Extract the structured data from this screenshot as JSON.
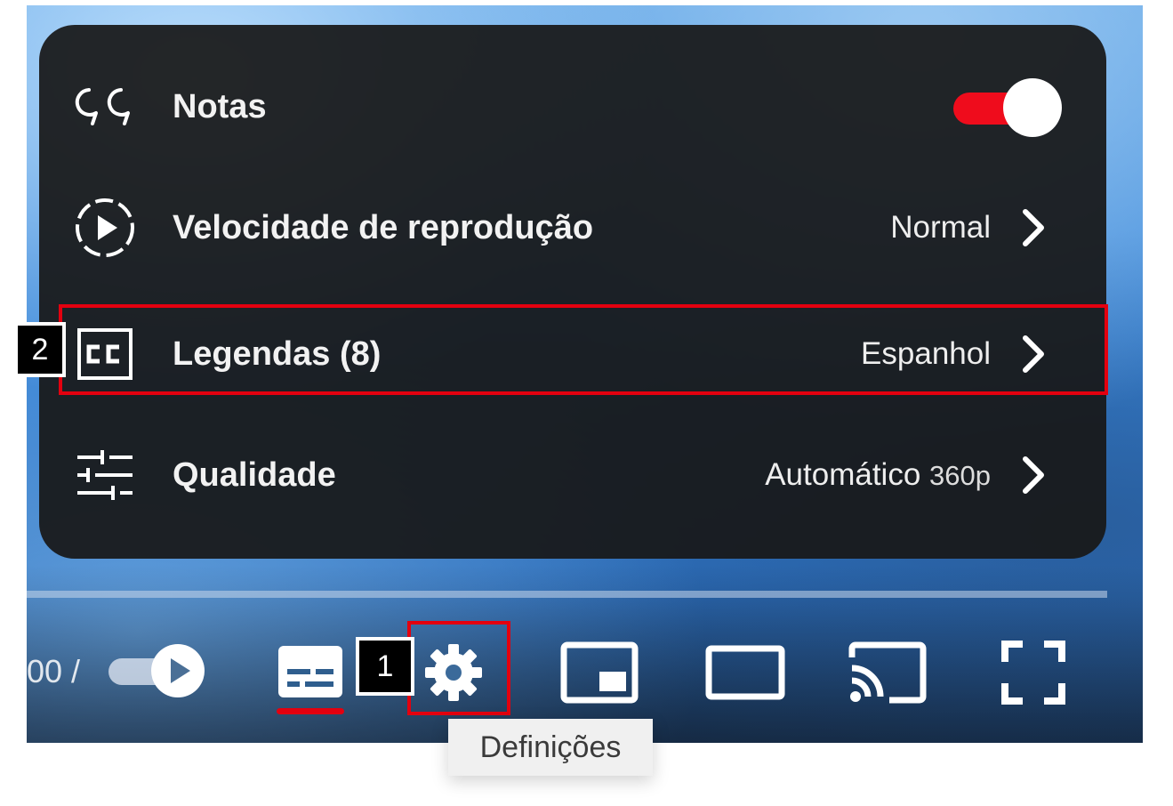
{
  "menu": {
    "items": [
      {
        "icon": "quote-notes-icon",
        "label": "Notas",
        "toggle_state": "on"
      },
      {
        "icon": "playback-speed-icon",
        "label": "Velocidade de reprodução",
        "value": "Normal"
      },
      {
        "icon": "closed-captions-icon",
        "label": "Legendas (8)",
        "value": "Espanhol"
      },
      {
        "icon": "quality-sliders-icon",
        "label": "Qualidade",
        "value": "Automático",
        "value_sub": "360p"
      }
    ]
  },
  "controls": {
    "time_text": "00 /",
    "tooltip": "Definições",
    "buttons": [
      "autoplay-toggle",
      "subtitles-button",
      "settings-button",
      "miniplayer-button",
      "theater-mode-button",
      "cast-button",
      "fullscreen-button"
    ]
  },
  "annotations": {
    "badge_1": "1",
    "badge_2": "2"
  },
  "colors": {
    "accent": "#ef0c1c",
    "annotation": "#e3000f",
    "menu_bg": "#181818"
  }
}
